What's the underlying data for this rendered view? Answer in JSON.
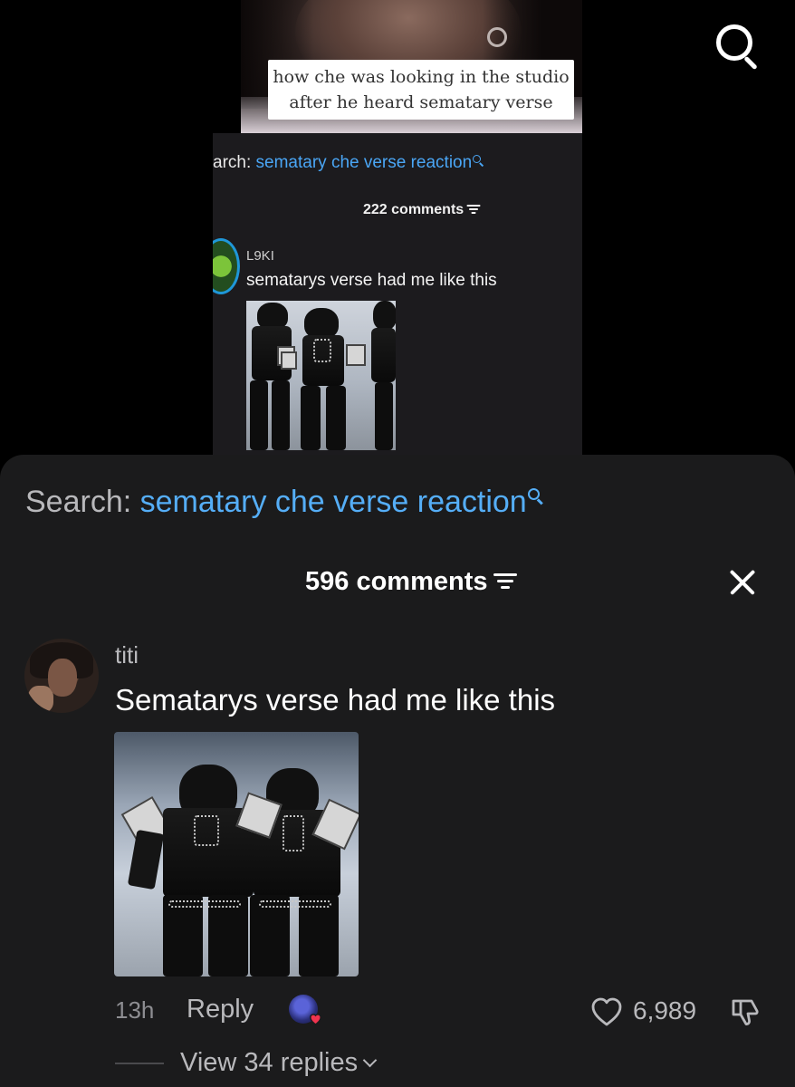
{
  "top_bar": {
    "search_icon": "search-icon"
  },
  "video": {
    "caption_line1": "how che was looking in the studio",
    "caption_line2": "after he heard sematary verse"
  },
  "embedded_comments": {
    "search_prefix": "arch: ",
    "search_term": "sematary che verse reaction",
    "count_label": "222 comments",
    "comment": {
      "username": "L9KI",
      "text": "sematarys verse had me like this"
    }
  },
  "comments_sheet": {
    "search_prefix": "Search: ",
    "search_term": "sematary che verse reaction",
    "count_label": "596 comments",
    "close_icon": "close-icon",
    "comment": {
      "username": "titi",
      "text": "Sematarys verse had me like this",
      "time": "13h",
      "reply_label": "Reply",
      "like_count": "6,989",
      "view_replies_label": "View 34 replies"
    }
  },
  "colors": {
    "search_term": "#55aef7",
    "sheet_bg": "#1b1b1c",
    "liked_by_creator_heart": "#f0344f"
  }
}
